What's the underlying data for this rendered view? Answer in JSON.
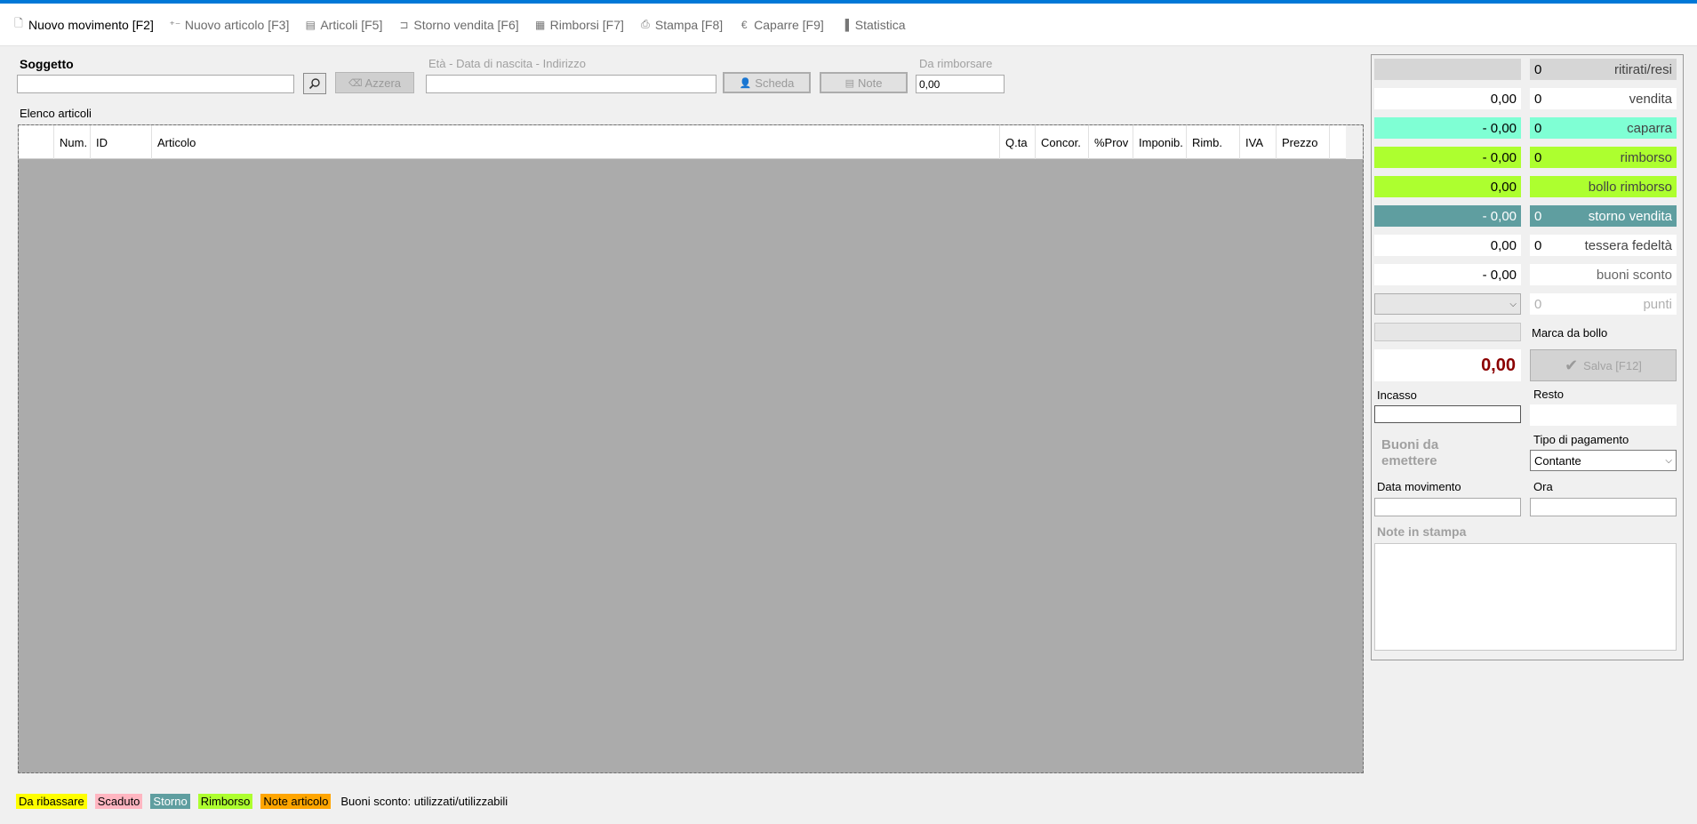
{
  "toolbar": {
    "items": [
      {
        "label": "Nuovo movimento [F2]",
        "icon": "document-icon"
      },
      {
        "label": "Nuovo articolo [F3]",
        "icon": "new-article-icon"
      },
      {
        "label": "Articoli [F5]",
        "icon": "articles-icon"
      },
      {
        "label": "Storno vendita [F6]",
        "icon": "storno-icon"
      },
      {
        "label": "Rimborsi [F7]",
        "icon": "refunds-icon"
      },
      {
        "label": "Stampa [F8]",
        "icon": "print-icon"
      },
      {
        "label": "Caparre [F9]",
        "icon": "euro-icon"
      },
      {
        "label": "Statistica",
        "icon": "chart-icon"
      }
    ]
  },
  "subject": {
    "label": "Soggetto",
    "value": "",
    "reset_label": "Azzera",
    "info_label": "Età - Data di nascita - Indirizzo",
    "info_value": "",
    "card_label": "Scheda",
    "notes_label": "Note",
    "refund_label": "Da rimborsare",
    "refund_value": "0,00"
  },
  "articles": {
    "title": "Elenco articoli",
    "columns": [
      "",
      "Num.",
      "ID",
      "Articolo",
      "Q.ta",
      "Concor.",
      "%Prov",
      "Imponib.",
      "Rimb.",
      "IVA",
      "Prezzo"
    ]
  },
  "legend": {
    "items": [
      {
        "label": "Da ribassare",
        "color": "#ffff00"
      },
      {
        "label": "Scaduto",
        "color": "#ffb6c1"
      },
      {
        "label": "Storno",
        "color": "#5f9ea0"
      },
      {
        "label": "Rimborso",
        "color": "#adff2f"
      },
      {
        "label": "Note articolo",
        "color": "#ffa500"
      }
    ],
    "vouchers_text": "Buoni sconto: utilizzati/utilizzabili"
  },
  "summary": {
    "rows": [
      {
        "amount": "",
        "count": "0",
        "label": "ritirati/resi"
      },
      {
        "amount": "0,00",
        "count": "0",
        "label": "vendita"
      },
      {
        "amount": "- 0,00",
        "count": "0",
        "label": "caparra"
      },
      {
        "amount": "- 0,00",
        "count": "0",
        "label": "rimborso"
      },
      {
        "amount": "0,00",
        "count": "",
        "label": "bollo rimborso"
      },
      {
        "amount": "- 0,00",
        "count": "0",
        "label": "storno vendita"
      },
      {
        "amount": "0,00",
        "count": "0",
        "label": "tessera fedeltà"
      },
      {
        "amount": "- 0,00",
        "count": "",
        "label": "buoni sconto"
      },
      {
        "amount": "",
        "count": "0",
        "label": "punti"
      }
    ],
    "stamp_label": "Marca da bollo",
    "total": "0,00",
    "save_label": "Salva [F12]",
    "incasso_label": "Incasso",
    "resto_label": "Resto",
    "vouchers_to_issue": "Buoni da emettere",
    "payment_type_label": "Tipo di pagamento",
    "payment_type_value": "Contante",
    "date_label": "Data movimento",
    "time_label": "Ora",
    "print_notes_label": "Note in stampa"
  }
}
